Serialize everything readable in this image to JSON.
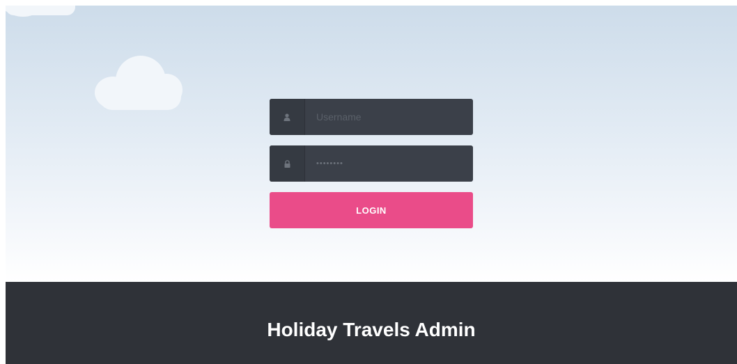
{
  "login": {
    "username_placeholder": "Username",
    "password_value": "••••••••",
    "button_label": "LOGIN",
    "user_icon": "user-icon",
    "lock_icon": "lock-icon"
  },
  "footer": {
    "title": "Holiday Travels Admin"
  },
  "colors": {
    "field_bg": "#3b4049",
    "button_bg": "#ea4c89",
    "footer_bg": "#2f3238",
    "sky_top": "#cddcea"
  }
}
